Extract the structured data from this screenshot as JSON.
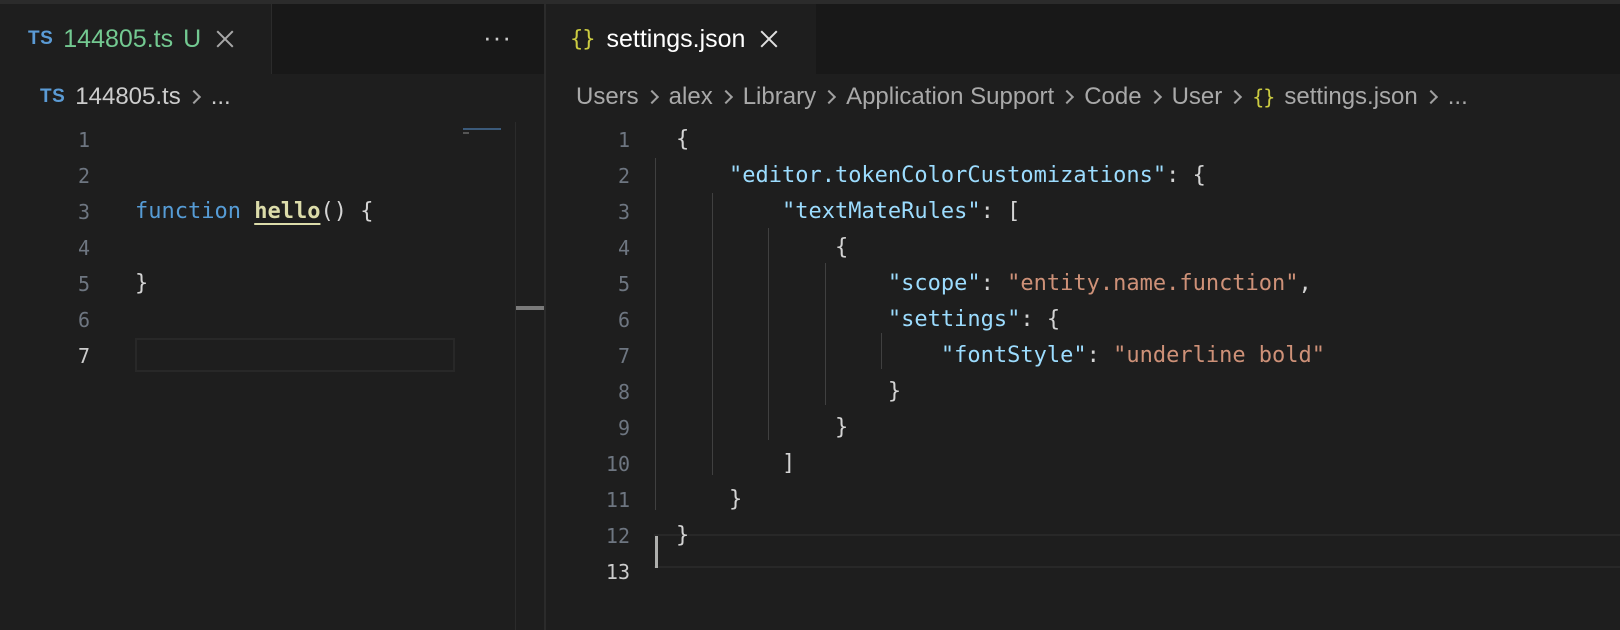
{
  "left_editor": {
    "tab": {
      "lang_badge": "TS",
      "filename": "144805.ts",
      "status": "U"
    },
    "more_actions": "···",
    "breadcrumb": {
      "lang_badge": "TS",
      "file": "144805.ts",
      "ellipsis": "..."
    },
    "line_numbers": [
      "1",
      "2",
      "3",
      "4",
      "5",
      "6",
      "7"
    ],
    "active_line": "7",
    "code": {
      "line3_keyword": "function",
      "line3_fn": "hello",
      "line3_rest": "() {",
      "line5": "}"
    }
  },
  "right_editor": {
    "tab": {
      "icon": "{}",
      "filename": "settings.json"
    },
    "breadcrumb": {
      "segments": [
        "Users",
        "alex",
        "Library",
        "Application Support",
        "Code",
        "User"
      ],
      "file_icon": "{}",
      "file": "settings.json",
      "ellipsis": "..."
    },
    "line_numbers": [
      "1",
      "2",
      "3",
      "4",
      "5",
      "6",
      "7",
      "8",
      "9",
      "10",
      "11",
      "12",
      "13"
    ],
    "active_line": "13",
    "code": {
      "l1": "{",
      "l2_key": "\"editor.tokenColorCustomizations\"",
      "l2_rest": ": {",
      "l3_key": "\"textMateRules\"",
      "l3_rest": ": [",
      "l4": "{",
      "l5_key": "\"scope\"",
      "l5_colon": ": ",
      "l5_val": "\"entity.name.function\"",
      "l5_comma": ",",
      "l6_key": "\"settings\"",
      "l6_rest": ": {",
      "l7_key": "\"fontStyle\"",
      "l7_colon": ": ",
      "l7_val": "\"underline bold\"",
      "l8": "}",
      "l9": "}",
      "l10": "]",
      "l11": "}",
      "l12": "}"
    }
  },
  "colors": {
    "editor_bg": "#1e1e1e",
    "keyword": "#569cd6",
    "function": "#dcdcaa",
    "json_key": "#9cdcfe",
    "string": "#ce9178",
    "untracked": "#73c991",
    "json_icon": "#cbcb41"
  }
}
